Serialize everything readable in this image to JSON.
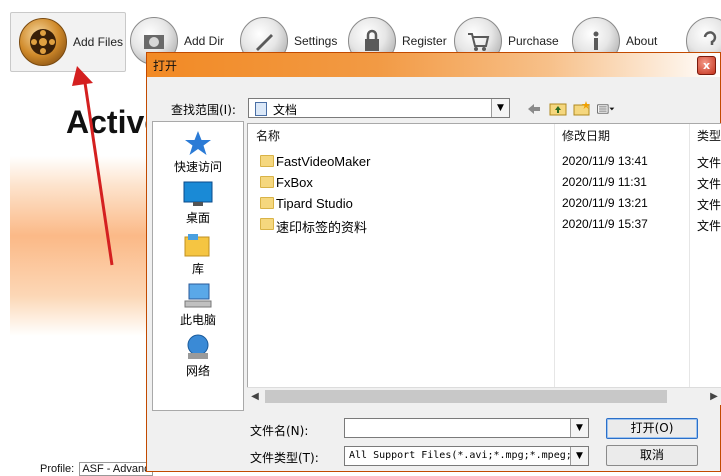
{
  "toolbar": {
    "items": [
      {
        "label": "Add Files",
        "icon": "film-reel-icon"
      },
      {
        "label": "Add Dir",
        "icon": "folder-disc-icon"
      },
      {
        "label": "Settings",
        "icon": "wrench-icon"
      },
      {
        "label": "Register",
        "icon": "lock-icon"
      },
      {
        "label": "Purchase",
        "icon": "cart-icon"
      },
      {
        "label": "About",
        "icon": "info-icon"
      }
    ]
  },
  "app": {
    "title_partial": "Active",
    "profile_label": "Profile:",
    "profile_value": "ASF - Advanc"
  },
  "dialog": {
    "title": "打开",
    "close_symbol": "x",
    "lookin_label": "查找范围(I):",
    "lookin_value": "文档",
    "places": [
      {
        "label": "快速访问",
        "icon": "star-icon"
      },
      {
        "label": "桌面",
        "icon": "desktop-icon"
      },
      {
        "label": "库",
        "icon": "library-icon"
      },
      {
        "label": "此电脑",
        "icon": "computer-icon"
      },
      {
        "label": "网络",
        "icon": "network-icon"
      }
    ],
    "columns": {
      "name": "名称",
      "date": "修改日期",
      "type": "类型"
    },
    "files": [
      {
        "name": "FastVideoMaker",
        "date": "2020/11/9 13:41",
        "type": "文件"
      },
      {
        "name": "FxBox",
        "date": "2020/11/9 11:31",
        "type": "文件"
      },
      {
        "name": "Tipard Studio",
        "date": "2020/11/9 13:21",
        "type": "文件"
      },
      {
        "name": "速印标签的资料",
        "date": "2020/11/9 15:37",
        "type": "文件"
      }
    ],
    "filename_label": "文件名(N):",
    "filename_value": "",
    "filetype_label": "文件类型(T):",
    "filetype_value": "All Support Files(*.avi;*.mpg;*.mpeg;",
    "open_button": "打开(O)",
    "cancel_button": "取消"
  },
  "colors": {
    "accent": "#f28a25",
    "annotation": "#d42020"
  }
}
